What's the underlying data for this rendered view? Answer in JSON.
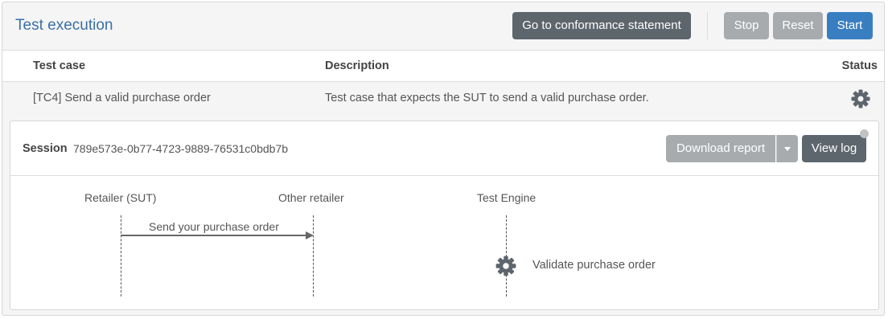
{
  "header": {
    "title": "Test execution",
    "buttons": {
      "conformance": "Go to conformance statement",
      "stop": "Stop",
      "reset": "Reset",
      "start": "Start"
    }
  },
  "table": {
    "columns": [
      "Test case",
      "Description",
      "Status"
    ],
    "rows": [
      {
        "test_case": "[TC4] Send a valid purchase order",
        "description": "Test case that expects the SUT to send a valid purchase order.",
        "status_icon": "gear-icon"
      }
    ]
  },
  "session": {
    "label": "Session",
    "id": "789e573e-0b77-4723-9889-76531c0bdb7b",
    "download_label": "Download report",
    "view_log_label": "View log"
  },
  "diagram": {
    "actors": [
      "Retailer (SUT)",
      "Other retailer",
      "Test Engine"
    ],
    "message": "Send your purchase order",
    "step": "Validate purchase order"
  },
  "colors": {
    "title": "#3a70a8",
    "primary": "#3a7ec2",
    "dark": "#5d656d",
    "disabled": "#a8abae"
  }
}
